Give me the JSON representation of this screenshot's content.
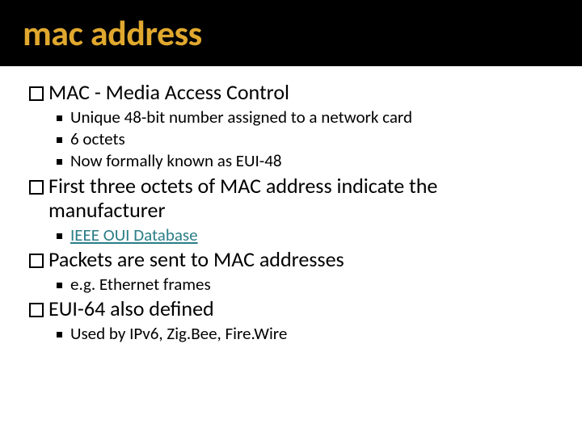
{
  "title": "mac address",
  "items": [
    {
      "text": "MAC - Media Access Control",
      "subs": [
        "Unique 48-bit number assigned to a network card",
        "6 octets",
        "Now formally known as EUI-48"
      ]
    },
    {
      "text": "First three octets of MAC address indicate the manufacturer",
      "subs_link": "IEEE OUI Database"
    },
    {
      "text": "Packets are sent to MAC addresses",
      "subs": [
        "e.g. Ethernet frames"
      ]
    },
    {
      "text": "EUI-64 also defined",
      "subs": [
        "Used by IPv6, Zig.Bee, Fire.Wire"
      ]
    }
  ]
}
